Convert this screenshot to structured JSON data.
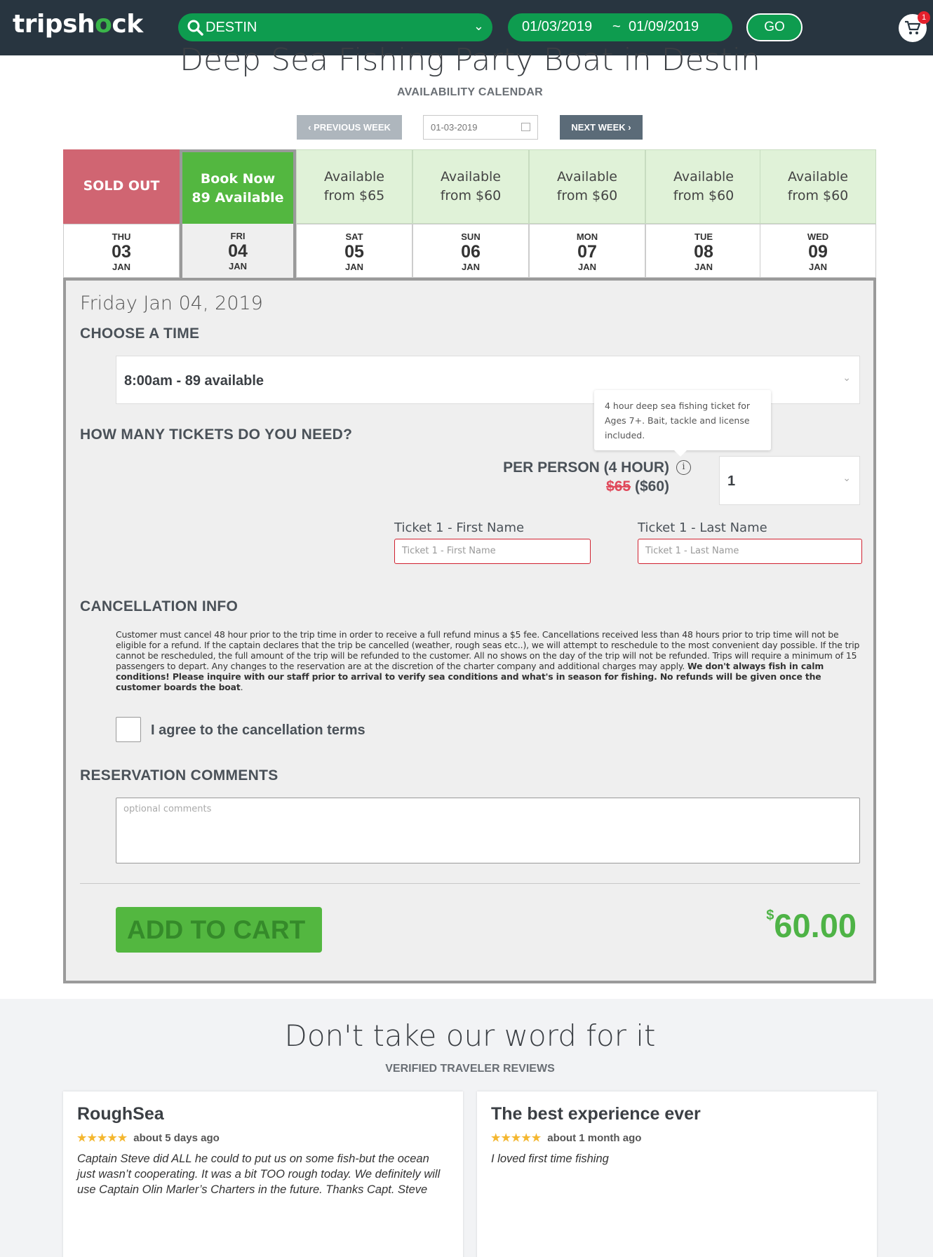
{
  "header": {
    "logo_left": "tripsh",
    "logo_o": "o",
    "logo_right": "ck",
    "search_value": "DESTIN",
    "date_from": "01/03/2019",
    "date_sep": "~",
    "date_to": "01/09/2019",
    "go_label": "GO",
    "cart_count": "1"
  },
  "page": {
    "title": "Deep Sea Fishing Party Boat in Destin",
    "subtitle": "AVAILABILITY CALENDAR"
  },
  "week_nav": {
    "prev_label": "PREVIOUS WEEK",
    "date_value": "01-03-2019",
    "next_label": "NEXT WEEK"
  },
  "calendar": [
    {
      "status_line1": "SOLD OUT",
      "status_line2": "",
      "dow": "THU",
      "day": "03",
      "month": "JAN",
      "state": "sold"
    },
    {
      "status_line1": "Book Now",
      "status_line2": "89 Available",
      "dow": "FRI",
      "day": "04",
      "month": "JAN",
      "state": "book"
    },
    {
      "status_line1": "Available",
      "status_line2": "from $65",
      "dow": "SAT",
      "day": "05",
      "month": "JAN",
      "state": "avail"
    },
    {
      "status_line1": "Available",
      "status_line2": "from $60",
      "dow": "SUN",
      "day": "06",
      "month": "JAN",
      "state": "avail"
    },
    {
      "status_line1": "Available",
      "status_line2": "from $60",
      "dow": "MON",
      "day": "07",
      "month": "JAN",
      "state": "avail"
    },
    {
      "status_line1": "Available",
      "status_line2": "from $60",
      "dow": "TUE",
      "day": "08",
      "month": "JAN",
      "state": "avail"
    },
    {
      "status_line1": "Available",
      "status_line2": "from $60",
      "dow": "WED",
      "day": "09",
      "month": "JAN",
      "state": "avail"
    }
  ],
  "booking": {
    "selected_date": "Friday Jan 04, 2019",
    "choose_time_heading": "CHOOSE A TIME",
    "time_value": "8:00am - 89 available",
    "tickets_heading": "HOW MANY TICKETS DO YOU NEED?",
    "tooltip": "4 hour deep sea fishing ticket for Ages 7+. Bait, tackle and license included.",
    "per_person_label": "PER PERSON (4 HOUR)",
    "price_old": "$65",
    "price_new": "($60)",
    "qty_value": "1",
    "first_name_label": "Ticket 1 - First Name",
    "first_name_placeholder": "Ticket 1 - First Name",
    "last_name_label": "Ticket 1 - Last Name",
    "last_name_placeholder": "Ticket 1 - Last Name",
    "cancellation_heading": "CANCELLATION INFO",
    "cancellation_text": "Customer must cancel 48 hour prior to the trip time in order to receive a full refund minus a $5 fee. Cancellations received less than 48 hours prior to trip time will not be eligible for a refund. If the captain declares that the trip be cancelled (weather, rough seas etc..), we will attempt to reschedule to the most convenient day possible. If the trip cannot be rescheduled, the full amount of the trip will be refunded to the customer. All no shows on the day of the trip will not be refunded. Trips will require a minimum of 15 passengers to depart. Any changes to the reservation are at the discretion of the charter company and additional charges may apply. ",
    "cancellation_bold": "We don't always fish in calm conditions! Please inquire with our staff prior to arrival to verify sea conditions and what's in season for fishing. No refunds will be given once the customer boards the boat",
    "cancellation_end": ".",
    "agree_label": "I agree to the cancellation terms",
    "comments_heading": "RESERVATION COMMENTS",
    "comments_placeholder": "optional comments",
    "add_to_cart_label": "ADD TO CART",
    "total_currency": "$",
    "total_amount": "60.00"
  },
  "reviews": {
    "title": "Don't take our word for it",
    "subtitle": "VERIFIED TRAVELER REVIEWS",
    "items": [
      {
        "title": "RoughSea",
        "stars": "★★★★★",
        "rating": 5,
        "when": "about 5 days ago",
        "body": "Captain Steve did ALL he could to put us on some fish-but the ocean just wasn’t cooperating. It was a bit TOO rough today. We definitely will use Captain Olin Marler’s Charters in the future. Thanks Capt. Steve"
      },
      {
        "title": "The best experience ever",
        "stars": "★★★★★",
        "rating": 5,
        "when": "about 1 month ago",
        "body": "I loved first time fishing"
      }
    ]
  },
  "colors": {
    "header_bg": "#283540",
    "brand_green": "#0e9c4f",
    "book_green": "#53b740",
    "sold_red": "#d06572",
    "avail_bg": "#e0f2d8",
    "total_green": "#4eb346"
  }
}
